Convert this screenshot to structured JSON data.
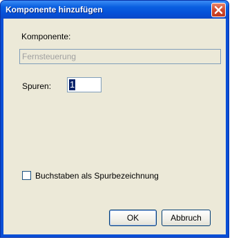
{
  "window": {
    "title": "Komponente hinzufügen",
    "close_icon": "close-x-icon",
    "accent": "#0a4fd6",
    "close_color": "#d0492e"
  },
  "form": {
    "komponente_label": "Komponente:",
    "komponente_value": "Fernsteuerung",
    "spuren_label": "Spuren:",
    "spuren_value": "1",
    "checkbox_label": "Buchstaben als Spurbezeichnung",
    "checkbox_checked": false
  },
  "buttons": {
    "ok_label": "OK",
    "cancel_label": "Abbruch"
  }
}
